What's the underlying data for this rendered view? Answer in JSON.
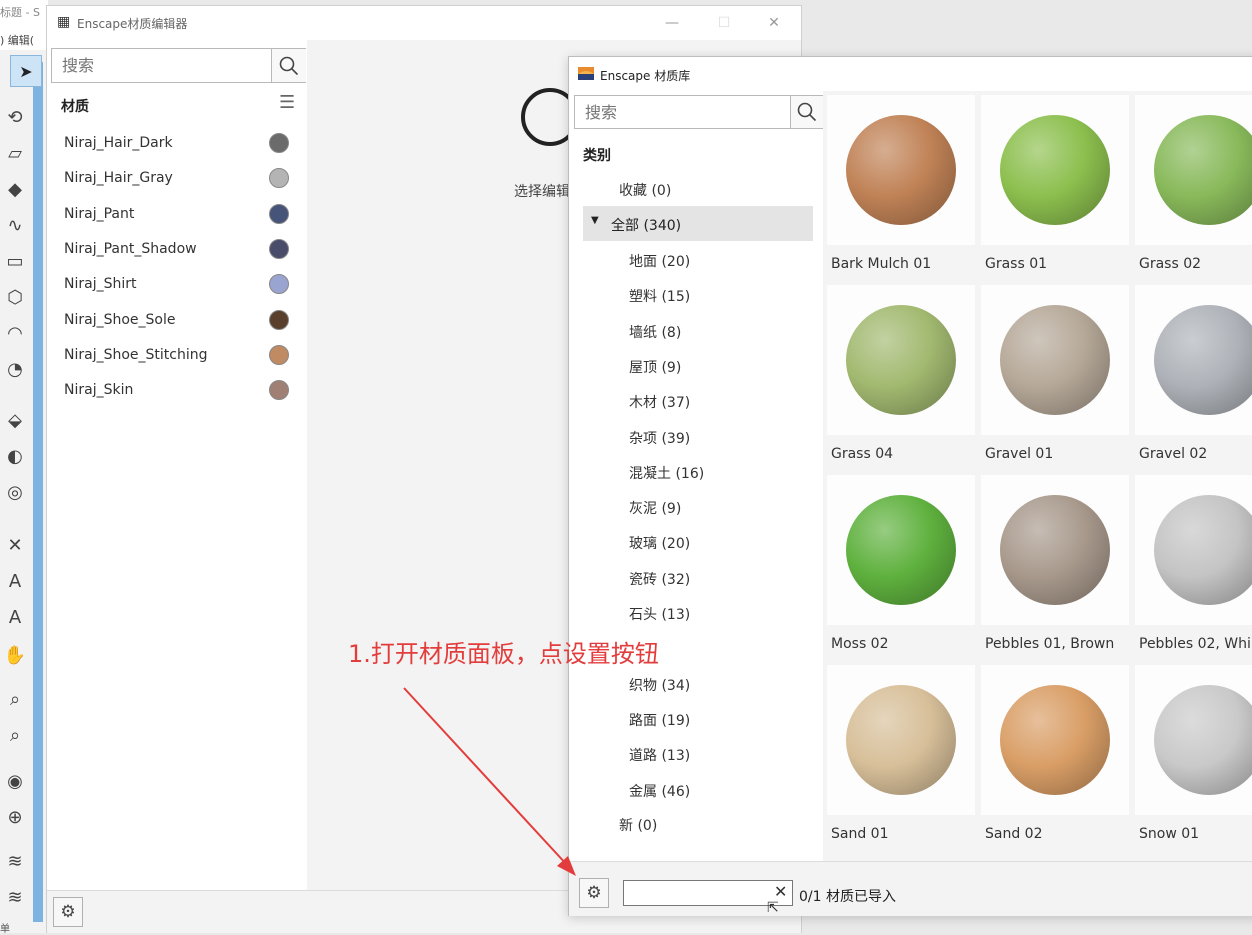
{
  "host": {
    "title": "标题 - S",
    "menu": ") 编辑(",
    "status": "单"
  },
  "editor": {
    "title": "Enscape材质编辑器",
    "search_placeholder": "搜索",
    "materials_header": "材质",
    "select_edit_text": "选择编辑",
    "materials": [
      {
        "name": "Niraj_Hair_Dark",
        "color": "#6b6b6b"
      },
      {
        "name": "Niraj_Hair_Gray",
        "color": "#b4b4b4"
      },
      {
        "name": "Niraj_Pant",
        "color": "#46547a"
      },
      {
        "name": "Niraj_Pant_Shadow",
        "color": "#494d6a"
      },
      {
        "name": "Niraj_Shirt",
        "color": "#9aa4d0"
      },
      {
        "name": "Niraj_Shoe_Sole",
        "color": "#5a402c"
      },
      {
        "name": "Niraj_Shoe_Stitching",
        "color": "#c08a62"
      },
      {
        "name": "Niraj_Skin",
        "color": "#a08074"
      }
    ]
  },
  "library": {
    "title": "Enscape 材质库",
    "search_placeholder": "搜索",
    "categories_header": "类别",
    "favorites": "收藏 (0)",
    "all_label": "全部 (340)",
    "categories": [
      "地面 (20)",
      "塑料 (15)",
      "墙纸 (8)",
      "屋顶 (9)",
      "木材 (37)",
      "杂项 (39)",
      "混凝土 (16)",
      "灰泥 (9)",
      "玻璃 (20)",
      "瓷砖 (32)",
      "石头 (13)",
      "",
      "织物 (34)",
      "路面 (19)",
      "道路 (13)",
      "金属 (46)"
    ],
    "new_label": "新 (0)",
    "import_status": "0/1 材质已导入",
    "tiles": [
      {
        "name": "Bark Mulch 01",
        "color": "#c08256"
      },
      {
        "name": "Grass 01",
        "color": "#8cbf4e"
      },
      {
        "name": "Grass 02",
        "color": "#88b95a"
      },
      {
        "name": "Grass 04",
        "color": "#a2b970"
      },
      {
        "name": "Gravel 01",
        "color": "#b5a898"
      },
      {
        "name": "Gravel 02",
        "color": "#aeb2b8"
      },
      {
        "name": "Moss 02",
        "color": "#5fb13e"
      },
      {
        "name": "Pebbles 01, Brown",
        "color": "#a8998c"
      },
      {
        "name": "Pebbles 02, Whi",
        "color": "#c4c4c4"
      },
      {
        "name": "Sand 01",
        "color": "#d7bf99"
      },
      {
        "name": "Sand 02",
        "color": "#d99e66"
      },
      {
        "name": "Snow 01",
        "color": "#c9c9c9"
      }
    ]
  },
  "annotation": {
    "text": "1.打开材质面板，点设置按钮",
    "color": "#e33c3c"
  }
}
